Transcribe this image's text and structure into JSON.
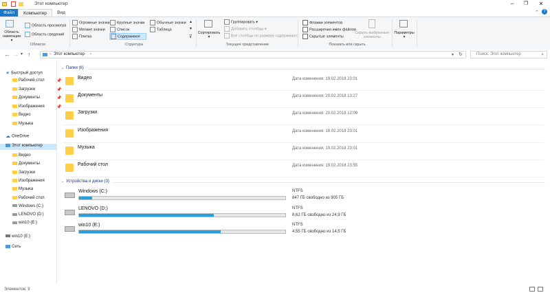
{
  "window": {
    "title": "Этот компьютер"
  },
  "ribbon_tabs": {
    "file": "Файл",
    "computer": "Компьютер",
    "view": "Вид"
  },
  "ribbon": {
    "panels": {
      "nav_pane": "Область навигации",
      "preview": "Область просмотра",
      "details": "Область сведений",
      "group_label": "Области"
    },
    "layout": {
      "huge": "Огромные значки",
      "large": "Крупные значки",
      "normal": "Обычные значки",
      "medium": "Мелкие значки",
      "list": "Список",
      "table": "Таблица",
      "tile": "Плитка",
      "content": "Содержимое",
      "group_label": "Структура"
    },
    "view": {
      "sort": "Сортировать",
      "group_by": "Группировать",
      "add_cols": "Добавить столбцы",
      "fit_cols": "Все столбцы по размеру содержимого",
      "group_label": "Текущее представление"
    },
    "show": {
      "checkboxes": "Флажки элементов",
      "extensions": "Расширения имен файлов",
      "hidden": "Скрытые элементы",
      "hide_selected": "Скрыть выбранные элементы",
      "group_label": "Показать или скрыть"
    },
    "options": "Параметры"
  },
  "address": {
    "path": "Этот компьютер",
    "search_placeholder": "Поиск: Этот компьютер"
  },
  "nav": {
    "quick_access": "Быстрый доступ",
    "quick_items": [
      "Рабочий стол",
      "Загрузки",
      "Документы",
      "Изображения",
      "Видео",
      "Музыка"
    ],
    "onedrive": "OneDrive",
    "this_pc": "Этот компьютер",
    "pc_items": [
      "Видео",
      "Документы",
      "Загрузки",
      "Изображения",
      "Музыка",
      "Рабочий стол",
      "Windows (C:)",
      "LENOVO (D:)",
      "win10 (E:)"
    ],
    "win10": "win10 (E:)",
    "network": "Сеть"
  },
  "folders_header": "Папки (6)",
  "folders": [
    {
      "name": "Видео",
      "date": "Дата изменения: 19.02.2018 23:01"
    },
    {
      "name": "Документы",
      "date": "Дата изменения: 20.02.2018 13:27"
    },
    {
      "name": "Загрузки",
      "date": "Дата изменения: 20.02.2018 12:09"
    },
    {
      "name": "Изображения",
      "date": "Дата изменения: 19.02.2018 23:01"
    },
    {
      "name": "Музыка",
      "date": "Дата изменения: 19.02.2018 23:01"
    },
    {
      "name": "Рабочий стол",
      "date": "Дата изменения: 19.02.2018 23:55"
    }
  ],
  "drives_header": "Устройства и диски (3)",
  "drives": [
    {
      "name": "Windows (C:)",
      "fs": "NTFS",
      "free": "847 ГБ свободно из 905 ГБ",
      "used_fraction": 0.064
    },
    {
      "name": "LENOVO (D:)",
      "fs": "NTFS",
      "free": "8,62 ГБ свободно из 24,9 ГБ",
      "used_fraction": 0.654
    },
    {
      "name": "win10 (E:)",
      "fs": "NTFS",
      "free": "4,55 ГБ свободно из 14,5 ГБ",
      "used_fraction": 0.686
    }
  ],
  "status": {
    "count": "Элементов: 9"
  },
  "colors": {
    "accent": "#1979ca",
    "bar": "#26a0da",
    "selection": "#cce8ff"
  }
}
